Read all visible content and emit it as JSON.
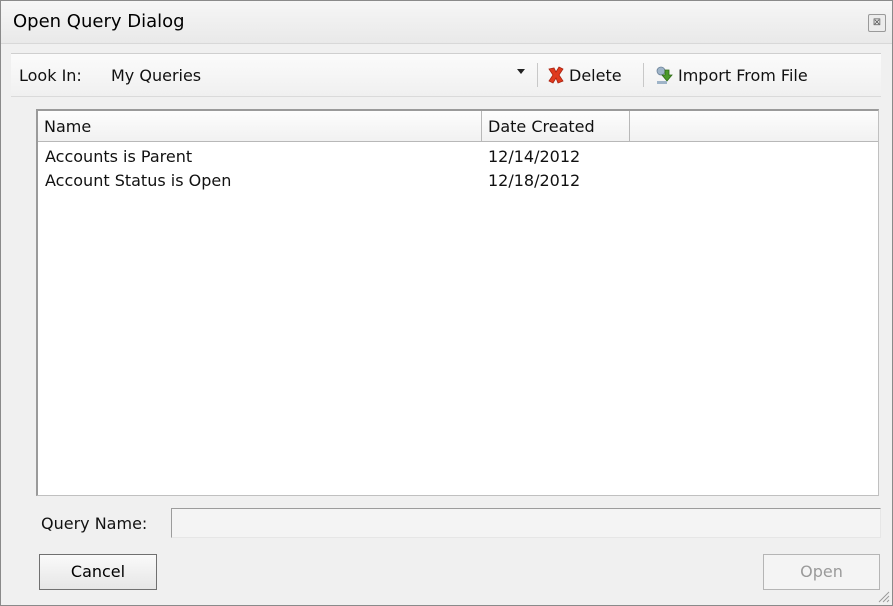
{
  "window": {
    "title": "Open Query Dialog",
    "close_icon": "close-icon"
  },
  "toolbar": {
    "lookin_label": "Look In:",
    "lookin_value": "My Queries",
    "delete_label": "Delete",
    "import_label": "Import From File"
  },
  "list": {
    "columns": [
      "Name",
      "Date Created"
    ],
    "rows": [
      {
        "name": "Accounts is Parent",
        "date": "12/14/2012"
      },
      {
        "name": "Account Status is Open",
        "date": "12/18/2012"
      }
    ]
  },
  "query_name": {
    "label": "Query Name:",
    "value": ""
  },
  "buttons": {
    "cancel": "Cancel",
    "open": "Open"
  },
  "colors": {
    "delete_icon": "#e03a1e",
    "import_icon": "#4c9a2a"
  }
}
